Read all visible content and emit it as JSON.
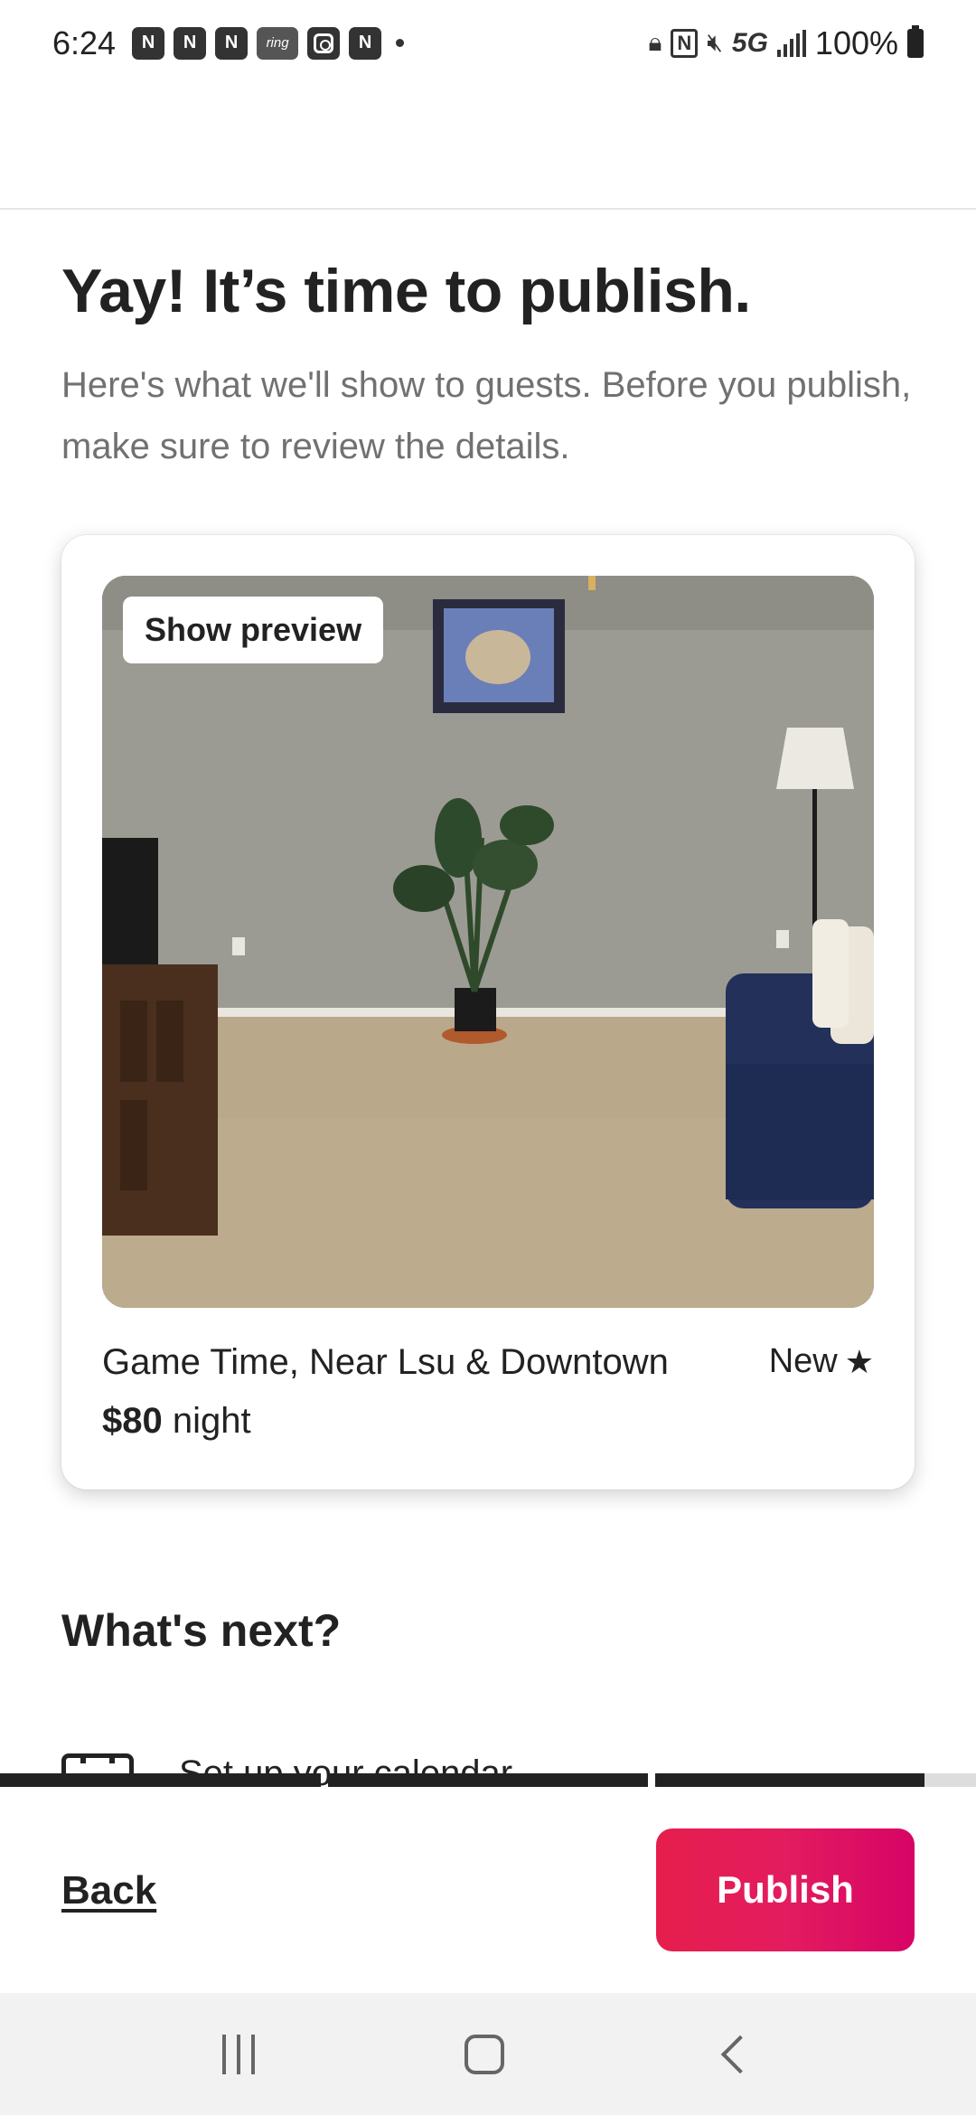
{
  "status_bar": {
    "time": "6:24",
    "app_icons": [
      "N",
      "N",
      "N",
      "ring",
      "instagram",
      "N"
    ],
    "ring_label": "ring",
    "network": "5G",
    "battery": "100%"
  },
  "header": {
    "title": "Yay! It’s time to publish.",
    "subtitle": "Here's what we'll show to guests. Before you publish, make sure to review the details."
  },
  "listing_card": {
    "preview_button": "Show preview",
    "name": "Game Time, Near Lsu & Downtown",
    "rating_label": "New",
    "price_amount": "$80",
    "price_unit": "night"
  },
  "whats_next": {
    "heading": "What's next?",
    "first_item": "Set up your calendar"
  },
  "progress": {
    "segments": 3,
    "completed_fraction": 0.95
  },
  "footer": {
    "back_label": "Back",
    "publish_label": "Publish"
  },
  "colors": {
    "publish_gradient_start": "#e61e4d",
    "publish_gradient_end": "#d70466",
    "text_primary": "#222222",
    "text_secondary": "#717171"
  }
}
